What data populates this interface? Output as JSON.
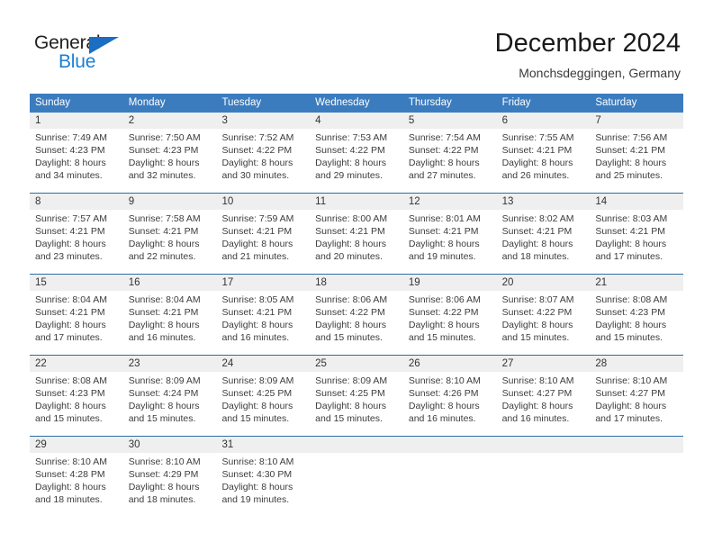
{
  "brand": {
    "name_part1": "General",
    "name_part2": "Blue",
    "accent_color": "#1b7fd4",
    "triangle_color": "#1b6ec2"
  },
  "header": {
    "title": "December 2024",
    "subtitle": "Monchsdeggingen, Germany"
  },
  "theme": {
    "header_row_bg": "#3b7cbf",
    "daynum_band_bg": "#efefef",
    "week_separator": "#2e6da4",
    "text_color": "#333333"
  },
  "weekdays": [
    "Sunday",
    "Monday",
    "Tuesday",
    "Wednesday",
    "Thursday",
    "Friday",
    "Saturday"
  ],
  "weeks": [
    {
      "days": [
        {
          "num": "1",
          "sunrise": "Sunrise: 7:49 AM",
          "sunset": "Sunset: 4:23 PM",
          "daylight1": "Daylight: 8 hours",
          "daylight2": "and 34 minutes."
        },
        {
          "num": "2",
          "sunrise": "Sunrise: 7:50 AM",
          "sunset": "Sunset: 4:23 PM",
          "daylight1": "Daylight: 8 hours",
          "daylight2": "and 32 minutes."
        },
        {
          "num": "3",
          "sunrise": "Sunrise: 7:52 AM",
          "sunset": "Sunset: 4:22 PM",
          "daylight1": "Daylight: 8 hours",
          "daylight2": "and 30 minutes."
        },
        {
          "num": "4",
          "sunrise": "Sunrise: 7:53 AM",
          "sunset": "Sunset: 4:22 PM",
          "daylight1": "Daylight: 8 hours",
          "daylight2": "and 29 minutes."
        },
        {
          "num": "5",
          "sunrise": "Sunrise: 7:54 AM",
          "sunset": "Sunset: 4:22 PM",
          "daylight1": "Daylight: 8 hours",
          "daylight2": "and 27 minutes."
        },
        {
          "num": "6",
          "sunrise": "Sunrise: 7:55 AM",
          "sunset": "Sunset: 4:21 PM",
          "daylight1": "Daylight: 8 hours",
          "daylight2": "and 26 minutes."
        },
        {
          "num": "7",
          "sunrise": "Sunrise: 7:56 AM",
          "sunset": "Sunset: 4:21 PM",
          "daylight1": "Daylight: 8 hours",
          "daylight2": "and 25 minutes."
        }
      ]
    },
    {
      "days": [
        {
          "num": "8",
          "sunrise": "Sunrise: 7:57 AM",
          "sunset": "Sunset: 4:21 PM",
          "daylight1": "Daylight: 8 hours",
          "daylight2": "and 23 minutes."
        },
        {
          "num": "9",
          "sunrise": "Sunrise: 7:58 AM",
          "sunset": "Sunset: 4:21 PM",
          "daylight1": "Daylight: 8 hours",
          "daylight2": "and 22 minutes."
        },
        {
          "num": "10",
          "sunrise": "Sunrise: 7:59 AM",
          "sunset": "Sunset: 4:21 PM",
          "daylight1": "Daylight: 8 hours",
          "daylight2": "and 21 minutes."
        },
        {
          "num": "11",
          "sunrise": "Sunrise: 8:00 AM",
          "sunset": "Sunset: 4:21 PM",
          "daylight1": "Daylight: 8 hours",
          "daylight2": "and 20 minutes."
        },
        {
          "num": "12",
          "sunrise": "Sunrise: 8:01 AM",
          "sunset": "Sunset: 4:21 PM",
          "daylight1": "Daylight: 8 hours",
          "daylight2": "and 19 minutes."
        },
        {
          "num": "13",
          "sunrise": "Sunrise: 8:02 AM",
          "sunset": "Sunset: 4:21 PM",
          "daylight1": "Daylight: 8 hours",
          "daylight2": "and 18 minutes."
        },
        {
          "num": "14",
          "sunrise": "Sunrise: 8:03 AM",
          "sunset": "Sunset: 4:21 PM",
          "daylight1": "Daylight: 8 hours",
          "daylight2": "and 17 minutes."
        }
      ]
    },
    {
      "days": [
        {
          "num": "15",
          "sunrise": "Sunrise: 8:04 AM",
          "sunset": "Sunset: 4:21 PM",
          "daylight1": "Daylight: 8 hours",
          "daylight2": "and 17 minutes."
        },
        {
          "num": "16",
          "sunrise": "Sunrise: 8:04 AM",
          "sunset": "Sunset: 4:21 PM",
          "daylight1": "Daylight: 8 hours",
          "daylight2": "and 16 minutes."
        },
        {
          "num": "17",
          "sunrise": "Sunrise: 8:05 AM",
          "sunset": "Sunset: 4:21 PM",
          "daylight1": "Daylight: 8 hours",
          "daylight2": "and 16 minutes."
        },
        {
          "num": "18",
          "sunrise": "Sunrise: 8:06 AM",
          "sunset": "Sunset: 4:22 PM",
          "daylight1": "Daylight: 8 hours",
          "daylight2": "and 15 minutes."
        },
        {
          "num": "19",
          "sunrise": "Sunrise: 8:06 AM",
          "sunset": "Sunset: 4:22 PM",
          "daylight1": "Daylight: 8 hours",
          "daylight2": "and 15 minutes."
        },
        {
          "num": "20",
          "sunrise": "Sunrise: 8:07 AM",
          "sunset": "Sunset: 4:22 PM",
          "daylight1": "Daylight: 8 hours",
          "daylight2": "and 15 minutes."
        },
        {
          "num": "21",
          "sunrise": "Sunrise: 8:08 AM",
          "sunset": "Sunset: 4:23 PM",
          "daylight1": "Daylight: 8 hours",
          "daylight2": "and 15 minutes."
        }
      ]
    },
    {
      "days": [
        {
          "num": "22",
          "sunrise": "Sunrise: 8:08 AM",
          "sunset": "Sunset: 4:23 PM",
          "daylight1": "Daylight: 8 hours",
          "daylight2": "and 15 minutes."
        },
        {
          "num": "23",
          "sunrise": "Sunrise: 8:09 AM",
          "sunset": "Sunset: 4:24 PM",
          "daylight1": "Daylight: 8 hours",
          "daylight2": "and 15 minutes."
        },
        {
          "num": "24",
          "sunrise": "Sunrise: 8:09 AM",
          "sunset": "Sunset: 4:25 PM",
          "daylight1": "Daylight: 8 hours",
          "daylight2": "and 15 minutes."
        },
        {
          "num": "25",
          "sunrise": "Sunrise: 8:09 AM",
          "sunset": "Sunset: 4:25 PM",
          "daylight1": "Daylight: 8 hours",
          "daylight2": "and 15 minutes."
        },
        {
          "num": "26",
          "sunrise": "Sunrise: 8:10 AM",
          "sunset": "Sunset: 4:26 PM",
          "daylight1": "Daylight: 8 hours",
          "daylight2": "and 16 minutes."
        },
        {
          "num": "27",
          "sunrise": "Sunrise: 8:10 AM",
          "sunset": "Sunset: 4:27 PM",
          "daylight1": "Daylight: 8 hours",
          "daylight2": "and 16 minutes."
        },
        {
          "num": "28",
          "sunrise": "Sunrise: 8:10 AM",
          "sunset": "Sunset: 4:27 PM",
          "daylight1": "Daylight: 8 hours",
          "daylight2": "and 17 minutes."
        }
      ]
    },
    {
      "days": [
        {
          "num": "29",
          "sunrise": "Sunrise: 8:10 AM",
          "sunset": "Sunset: 4:28 PM",
          "daylight1": "Daylight: 8 hours",
          "daylight2": "and 18 minutes."
        },
        {
          "num": "30",
          "sunrise": "Sunrise: 8:10 AM",
          "sunset": "Sunset: 4:29 PM",
          "daylight1": "Daylight: 8 hours",
          "daylight2": "and 18 minutes."
        },
        {
          "num": "31",
          "sunrise": "Sunrise: 8:10 AM",
          "sunset": "Sunset: 4:30 PM",
          "daylight1": "Daylight: 8 hours",
          "daylight2": "and 19 minutes."
        },
        {
          "num": "",
          "sunrise": "",
          "sunset": "",
          "daylight1": "",
          "daylight2": ""
        },
        {
          "num": "",
          "sunrise": "",
          "sunset": "",
          "daylight1": "",
          "daylight2": ""
        },
        {
          "num": "",
          "sunrise": "",
          "sunset": "",
          "daylight1": "",
          "daylight2": ""
        },
        {
          "num": "",
          "sunrise": "",
          "sunset": "",
          "daylight1": "",
          "daylight2": ""
        }
      ]
    }
  ]
}
